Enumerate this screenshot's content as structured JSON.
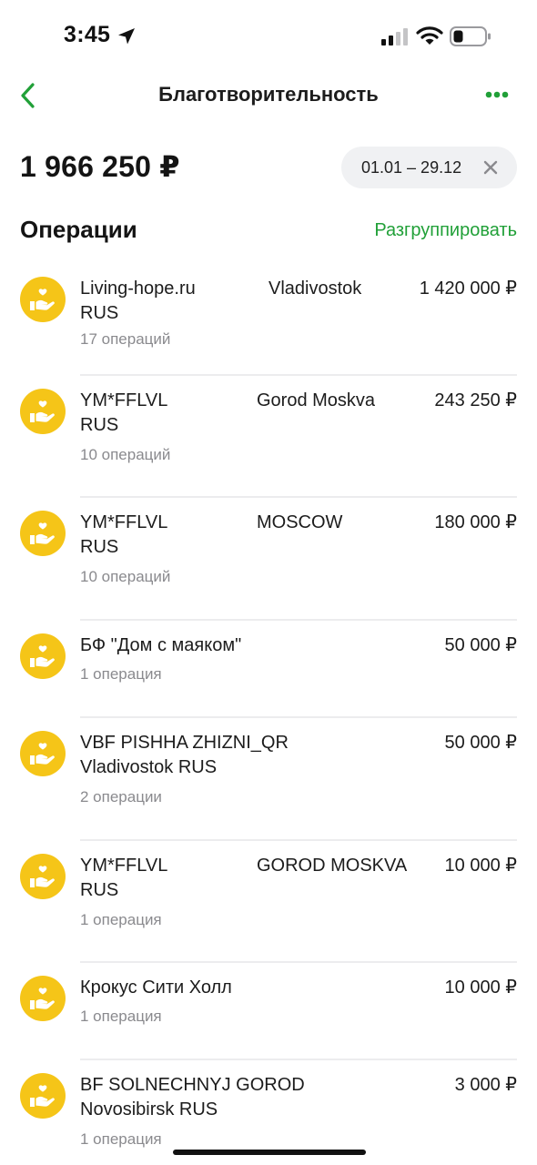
{
  "status_bar": {
    "time": "3:45"
  },
  "header": {
    "title": "Благотворительность"
  },
  "summary": {
    "total": "1 966 250 ₽",
    "period": "01.01 – 29.12"
  },
  "section": {
    "title": "Операции",
    "ungroup_label": "Разгруппировать"
  },
  "colors": {
    "accent": "#21a038",
    "icon_bg": "#f5c518",
    "divider": "#ececee",
    "secondary_text": "#8a8a8e"
  },
  "operations": [
    {
      "name": "Living-hope.ru\nRUS",
      "city": "Vladivostok",
      "amount": "1 420 000 ₽",
      "count": "17 операций",
      "icon": "charity-hand-heart-icon"
    },
    {
      "name": "YM*FFLVL\nRUS",
      "city": "Gorod Moskva",
      "amount": "243 250 ₽",
      "count": "10 операций",
      "icon": "charity-hand-heart-icon"
    },
    {
      "name": "YM*FFLVL\nRUS",
      "city": "MOSCOW",
      "amount": "180 000 ₽",
      "count": "10 операций",
      "icon": "charity-hand-heart-icon"
    },
    {
      "name": "БФ \"Дом с маяком\"",
      "city": "",
      "amount": "50 000 ₽",
      "count": "1 операция",
      "icon": "charity-hand-heart-icon"
    },
    {
      "name": "VBF PISHHA ZHIZNI_QR\nVladivostok  RUS",
      "city": "",
      "amount": "50 000 ₽",
      "count": "2 операции",
      "icon": "charity-hand-heart-icon"
    },
    {
      "name": "YM*FFLVL\nRUS",
      "city": "GOROD MOSKVA",
      "amount": "10 000 ₽",
      "count": "1 операция",
      "icon": "charity-hand-heart-icon"
    },
    {
      "name": "Крокус Сити Холл",
      "city": "",
      "amount": "10 000 ₽",
      "count": "1 операция",
      "icon": "charity-hand-heart-icon"
    },
    {
      "name": "BF SOLNECHNYJ GOROD\nNovosibirsk  RUS",
      "city": "",
      "amount": "3 000 ₽",
      "count": "1 операция",
      "icon": "charity-hand-heart-icon"
    }
  ]
}
